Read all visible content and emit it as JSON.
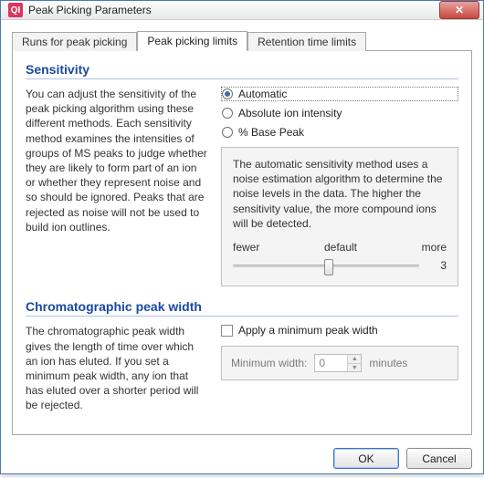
{
  "window": {
    "app_icon_text": "QI",
    "title": "Peak Picking Parameters"
  },
  "tabs": [
    {
      "label": "Runs for peak picking",
      "active": false
    },
    {
      "label": "Peak picking limits",
      "active": true
    },
    {
      "label": "Retention time limits",
      "active": false
    }
  ],
  "sensitivity": {
    "title": "Sensitivity",
    "description": "You can adjust the sensitivity of the peak picking algorithm using these different methods. Each sensitivity method examines the intensities of groups of MS peaks to judge whether they are likely to form part of an ion or whether they represent noise and so should be ignored. Peaks that are rejected as noise will not be used to build ion outlines.",
    "options": {
      "automatic": "Automatic",
      "absolute": "Absolute ion intensity",
      "basepeak": "% Base Peak",
      "selected": "automatic"
    },
    "info": "The automatic sensitivity method uses a noise estimation algorithm to determine the noise levels in the data. The higher the sensitivity value, the more compound ions will be detected.",
    "slider": {
      "fewer": "fewer",
      "default": "default",
      "more": "more",
      "value": "3"
    }
  },
  "chrom": {
    "title": "Chromatographic peak width",
    "description": "The chromatographic peak width gives the length of time over which an ion has eluted. If you set a minimum peak width, any ion that has eluted over a shorter period will be rejected.",
    "apply_label": "Apply a minimum peak width",
    "apply_checked": false,
    "min_label": "Minimum width:",
    "min_value": "0",
    "min_unit": "minutes"
  },
  "buttons": {
    "ok": "OK",
    "cancel": "Cancel"
  }
}
